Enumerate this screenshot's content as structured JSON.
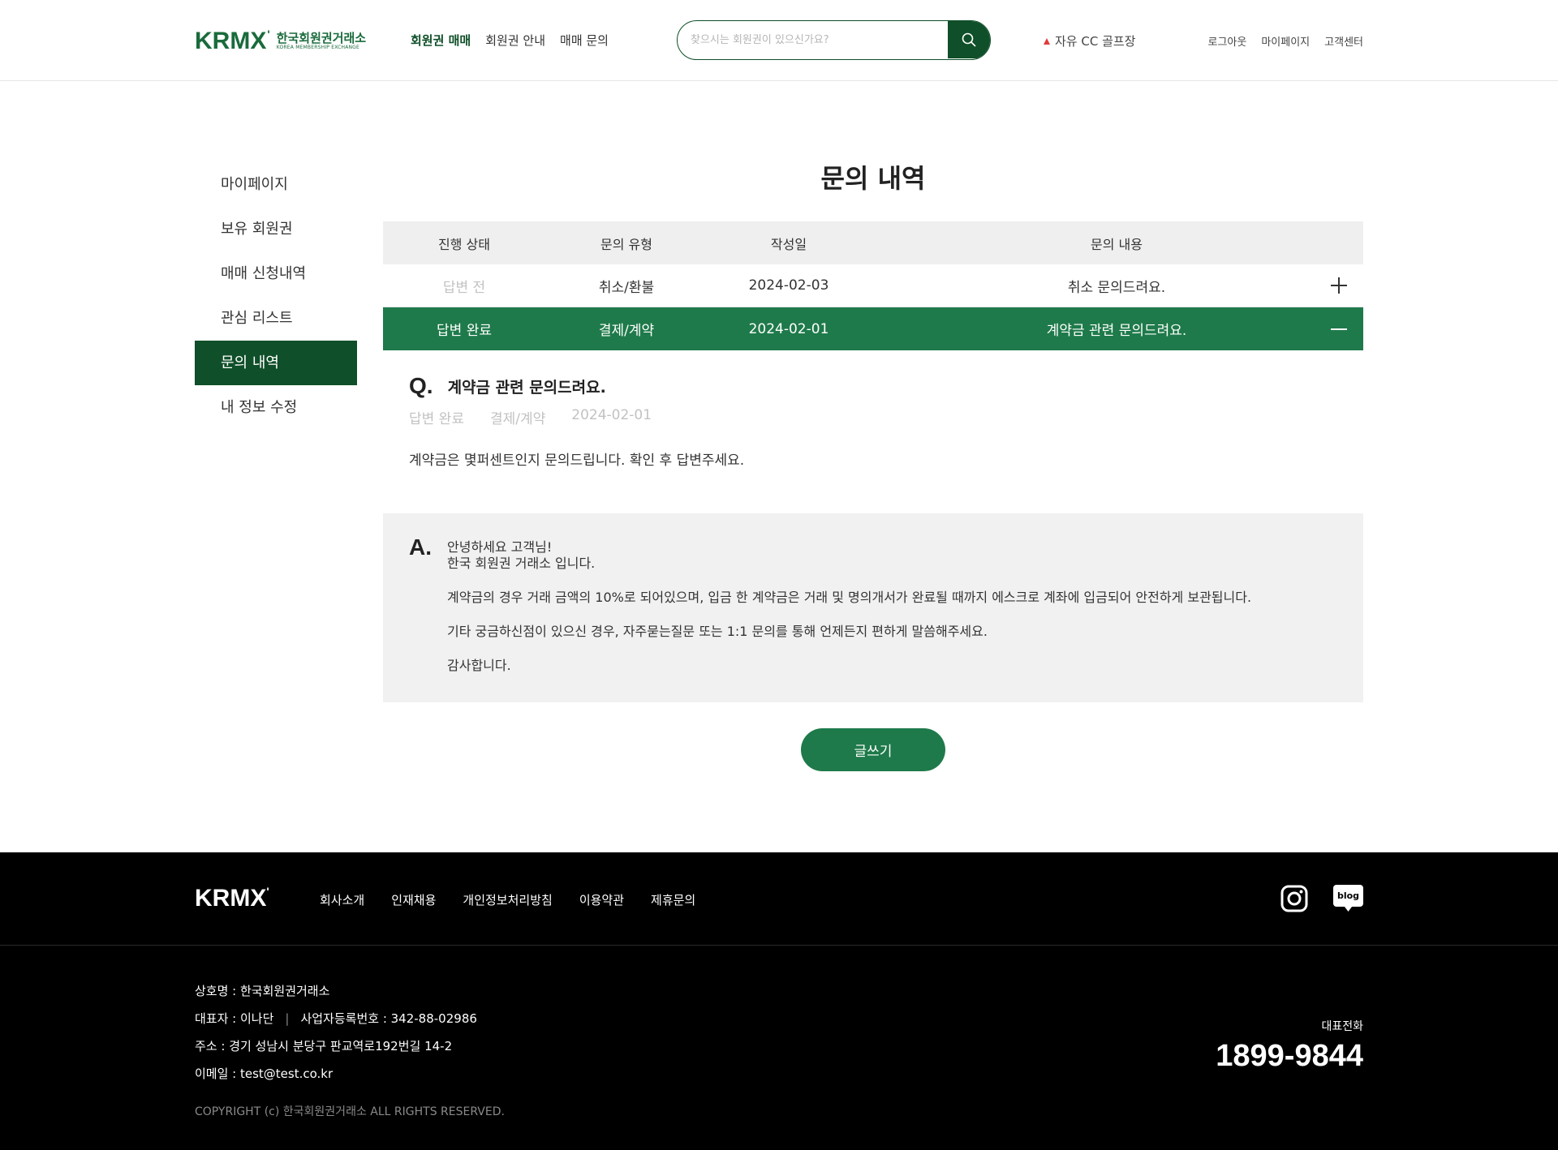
{
  "header": {
    "logo_mark": "KRMX",
    "logo_mark_sup": "'",
    "logo_kr": "한국회원권거래소",
    "logo_en": "KOREA MEMBERSHIP EXCHANGE",
    "gnb": [
      "회원권 매매",
      "회원권 안내",
      "매매 문의"
    ],
    "search_placeholder": "찾으시는 회원권이 있으신가요?",
    "ticker": "자유 CC 골프장",
    "util": [
      "로그아웃",
      "마이페이지",
      "고객센터"
    ],
    "accent_color": "#0f4f29"
  },
  "sidebar": {
    "items": [
      "마이페이지",
      "보유 회원권",
      "매매 신청내역",
      "관심 리스트",
      "문의 내역",
      "내 정보 수정"
    ],
    "active_index": 4
  },
  "main": {
    "title": "문의 내역",
    "table": {
      "headers": [
        "진행 상태",
        "문의 유형",
        "작성일",
        "문의 내용"
      ],
      "rows": [
        {
          "status": "답변 전",
          "type": "취소/환불",
          "date": "2024-02-03",
          "content": "취소 문의드려요.",
          "expanded": false
        },
        {
          "status": "답변 완료",
          "type": "결제/계약",
          "date": "2024-02-01",
          "content": "계약금 관련 문의드려요.",
          "expanded": true
        }
      ]
    },
    "question": {
      "mark": "Q.",
      "title": "계약금 관련 문의드려요.",
      "status": "답변 완료",
      "type": "결제/계약",
      "date": "2024-02-01",
      "body": "계약금은 몇퍼센트인지 문의드립니다. 확인 후 답변주세요."
    },
    "answer": {
      "mark": "A.",
      "line1": "안녕하세요 고객님!",
      "line2": "한국 회원권 거래소 입니다.",
      "line3": "계약금의 경우 거래 금액의 10%로 되어있으며, 입금 한 계약금은 거래 및 명의개서가 완료될 때까지 에스크로 계좌에 입금되어 안전하게 보관됩니다.",
      "line4": "기타 궁금하신점이 있으신 경우, 자주묻는질문 또는 1:1 문의를 통해 언제든지 편하게 말씀해주세요.",
      "line5": "감사합니다."
    },
    "write_button": "글쓰기",
    "row_accent_color": "#1e7a4a"
  },
  "footer": {
    "logo": "KRMX",
    "logo_sup": "'",
    "nav": [
      "회사소개",
      "인재채용",
      "개인정보처리방침",
      "이용약관",
      "제휴문의"
    ],
    "icons": [
      "instagram-icon",
      "blog-icon"
    ],
    "blog_label": "blog",
    "company": "상호명 : 한국회원권거래소",
    "ceo": "대표자 : 이나단",
    "biz_no": "사업자등록번호 : 342-88-02986",
    "address": "주소 : 경기 성남시 분당구 판교역로192번길 14-2",
    "email": "이메일 : test@test.co.kr",
    "copyright": "COPYRIGHT (c) 한국회원권거래소 ALL RIGHTS RESERVED.",
    "phone_label": "대표전화",
    "phone": "1899-9844"
  }
}
